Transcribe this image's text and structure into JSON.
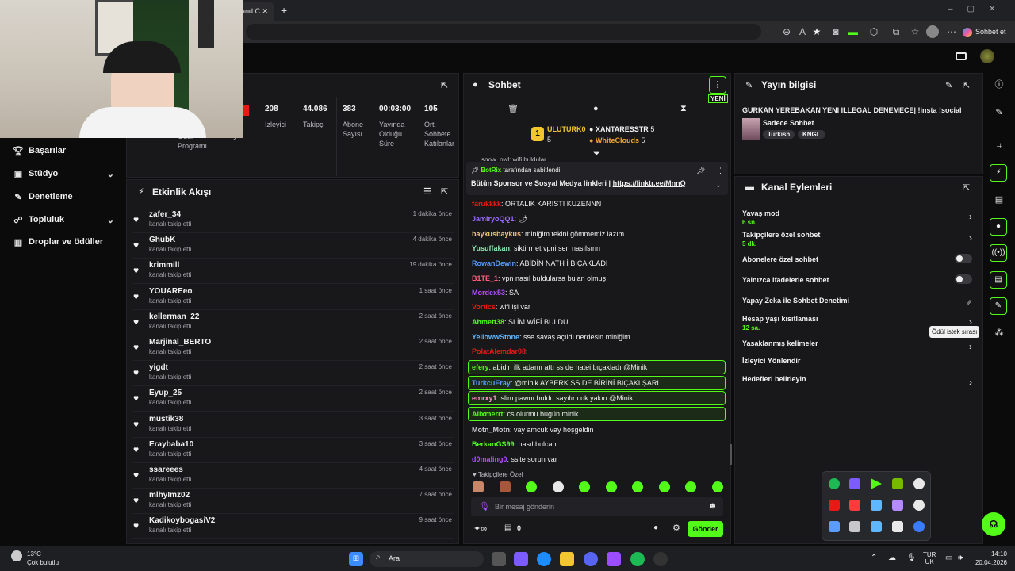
{
  "browser": {
    "tab_title": "and C",
    "new_tab": "+",
    "profile_label": "Sohbet et"
  },
  "stream": {
    "stats": [
      {
        "value": "208",
        "label": "İzleyici"
      },
      {
        "value": "44.086",
        "label": "Takipçi"
      },
      {
        "value": "383",
        "label": "Abone Sayısı"
      },
      {
        "value": "00:03:00",
        "label": "Yayında Olduğu Süre"
      },
      {
        "value": "105",
        "label": "Ort. Sohbete Katılanlar"
      }
    ],
    "partial_labels": [
      "Ödül Programı",
      "Yayın"
    ]
  },
  "nav": {
    "items": [
      {
        "label": "Başarılar",
        "icon": "trophy-icon"
      },
      {
        "label": "Stüdyo",
        "icon": "studio-icon",
        "chevron": "⌄"
      },
      {
        "label": "Denetleme",
        "icon": "wrench-icon"
      },
      {
        "label": "Topluluk",
        "icon": "community-icon",
        "chevron": "⌄"
      },
      {
        "label": "Droplar ve ödüller",
        "icon": "drops-icon"
      }
    ]
  },
  "activity": {
    "title": "Etkinlik Akışı",
    "items": [
      {
        "name": "zafer_34",
        "action": "kanalı takip etti",
        "time": "1 dakika önce"
      },
      {
        "name": "GhubK",
        "action": "kanalı takip etti",
        "time": "4 dakika önce"
      },
      {
        "name": "krimmill",
        "action": "kanalı takip etti",
        "time": "19 dakika önce"
      },
      {
        "name": "YOUAREeo",
        "action": "kanalı takip etti",
        "time": "1 saat önce"
      },
      {
        "name": "kellerman_22",
        "action": "kanalı takip etti",
        "time": "2 saat önce"
      },
      {
        "name": "Marjinal_BERTO",
        "action": "kanalı takip etti",
        "time": "2 saat önce"
      },
      {
        "name": "yigdt",
        "action": "kanalı takip etti",
        "time": "2 saat önce"
      },
      {
        "name": "Eyup_25",
        "action": "kanalı takip etti",
        "time": "2 saat önce"
      },
      {
        "name": "mustik38",
        "action": "kanalı takip etti",
        "time": "3 saat önce"
      },
      {
        "name": "Eraybaba10",
        "action": "kanalı takip etti",
        "time": "3 saat önce"
      },
      {
        "name": "ssareees",
        "action": "kanalı takip etti",
        "time": "4 saat önce"
      },
      {
        "name": "mlhyImz02",
        "action": "kanalı takip etti",
        "time": "7 saat önce"
      },
      {
        "name": "KadikoybogasiV2",
        "action": "kanalı takip etti",
        "time": "9 saat önce"
      }
    ]
  },
  "chat": {
    "title": "Sohbet",
    "new_badge": "YENİ",
    "leaders": [
      {
        "name": "ULUTURK0",
        "count": "5"
      },
      {
        "name": "XANTARESSTR",
        "count": "5"
      },
      {
        "name": "WhiteClouds",
        "count": "5"
      }
    ],
    "partial_top": "snow_owl: wifi buldular",
    "pinned": {
      "by_user": "BotRix",
      "by_suffix": "tarafından sabitlendi",
      "text": "Bütün Sponsor ve Sosyal Medya linkleri |",
      "link": "https://linktr.ee/MnnQ"
    },
    "messages": [
      {
        "user": "farukkkk",
        "text": ": ORTALIK KARISTI KUZENNN",
        "color": "#e91916"
      },
      {
        "user": "JamiryoQQ1",
        "text": ": 🌶",
        "color": "#9b6bff"
      },
      {
        "user": "baykusbaykus",
        "text": ": miniğim tekini gömmemiz lazım",
        "color": "#f0c674"
      },
      {
        "user": "Yusuffakan",
        "text": ": siktirrr et vpni sen nasılsınn",
        "color": "#8ee8b0"
      },
      {
        "user": "RowanDewin",
        "text": ": ABİDİN NATH İ BIÇAKLADI",
        "color": "#5a9cff"
      },
      {
        "user": "B1TE_1",
        "text": ": vpn nasıl buldularsa bulan olmuş",
        "color": "#ff5c7c"
      },
      {
        "user": "Mordex53",
        "text": ": SA",
        "color": "#b44dff"
      },
      {
        "user": "Vortics",
        "text": ": wifi işi var",
        "color": "#e91916"
      },
      {
        "user": "Ahmett38",
        "text": ": SLİM WİFİ BULDU",
        "color": "#53fc18"
      },
      {
        "user": "YellowwStone",
        "text": ": sse savaş açıldı nerdesin miniğim",
        "color": "#5fb8ff"
      },
      {
        "user": "PolatAlemdar08",
        "text": ":",
        "color": "#e91916"
      },
      {
        "user": "efery",
        "text": ": abidin ilk adamı attı ss de natei bıçakladı @Minik",
        "color": "#53fc18"
      },
      {
        "user": "TurkcuEray",
        "text": ": @minik AYBERK SS DE BİRİNİ BIÇAKLŞARI",
        "color": "#5a9cff"
      },
      {
        "user": "emrxy1",
        "text": ": slim pawnı buldu sayılır cok yakın @Minik",
        "color": "#ff8fd1"
      },
      {
        "user": "Alixmerrt",
        "text": ": cs olurmu bugün minik",
        "color": "#53fc18"
      },
      {
        "user": "Motn_Motn",
        "text": ": vay amcuk vay hoşgeldin",
        "color": "#c8c8cc"
      },
      {
        "user": "BerkanGS99",
        "text": ": nasıl bulcan",
        "color": "#53fc18"
      },
      {
        "user": "d0maling0",
        "text": ": ss'te sorun var",
        "color": "#b44dff"
      }
    ],
    "followers_only": "Takipçilere Özel",
    "input_placeholder": "Bir mesaj gönderin",
    "points": "0",
    "send_label": "Gönder"
  },
  "stream_info": {
    "title": "Yayın bilgisi",
    "stream_title": "GURKAN YEREBAKAN YENI ILLEGAL DENEMECE| !insta !social",
    "category": "Sadece Sohbet",
    "tags": [
      "Turkish",
      "KNGL"
    ]
  },
  "channel_actions": {
    "title": "Kanal Eylemleri",
    "items": [
      {
        "label": "Yavaş mod",
        "sub": "6 sn.",
        "control": "arrow"
      },
      {
        "label": "Takipçilere özel sohbet",
        "sub": "5 dk.",
        "control": "arrow"
      },
      {
        "label": "Abonelere özel sohbet",
        "sub": "",
        "control": "toggle"
      },
      {
        "label": "Yalnızca ifadelerle sohbet",
        "sub": "",
        "control": "toggle"
      },
      {
        "label": "Yapay Zeka ile Sohbet Denetimi",
        "sub": "",
        "control": "external"
      },
      {
        "label": "Hesap yaşı kısıtlaması",
        "sub": "12 sa.",
        "control": "arrow"
      },
      {
        "label": "Yasaklanmış kelimeler",
        "sub": "",
        "control": "arrow"
      },
      {
        "label": "İzleyici Yönlendir",
        "sub": "",
        "control": "none"
      },
      {
        "label": "Hedefleri belirleyin",
        "sub": "",
        "control": "arrow"
      }
    ]
  },
  "rail": {
    "tooltip": "Ödül istek sırası"
  },
  "taskbar": {
    "weather_temp": "13°C",
    "weather_desc": "Çok bulutlu",
    "search_label": "Ara",
    "lang_top": "TUR",
    "lang_bottom": "UK",
    "time": "14:10",
    "date": "20.04.2026"
  },
  "colors": {
    "accent": "#53fc18",
    "panel": "#18181b",
    "background": "#0b0b0c"
  }
}
